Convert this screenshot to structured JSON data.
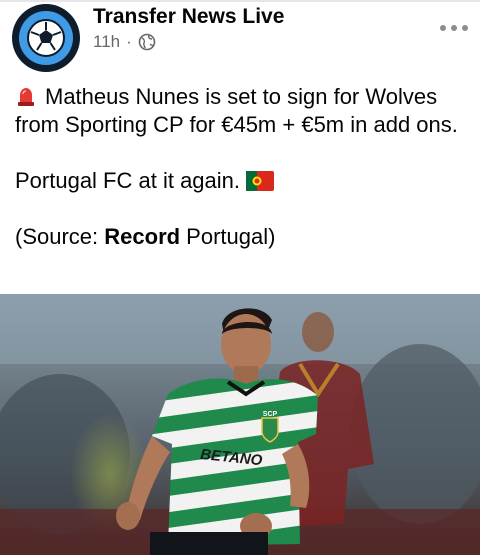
{
  "post": {
    "author": "Transfer News Live",
    "time": "11h",
    "separator": "·",
    "line1": "Matheus Nunes is set to sign for Wolves from Sporting CP for €45m + €5m in add ons.",
    "line2": "Portugal FC at it again.",
    "source_prefix": "(Source: ",
    "source_bold": "Record",
    "source_suffix": " Portugal)"
  },
  "photo": {
    "sponsor_text": "BETANO",
    "crest_text": "SCP"
  },
  "colors": {
    "avatar_ring": "#0f1c2c",
    "avatar_fill": "#3f9be6",
    "meta_gray": "#65676b",
    "kit_green": "#1f8a4c",
    "kit_white": "#f2f2f2"
  },
  "icons": {
    "globe": "globe-icon",
    "more": "more-options-icon",
    "siren": "police-light-icon",
    "flag": "portugal-flag-icon"
  }
}
